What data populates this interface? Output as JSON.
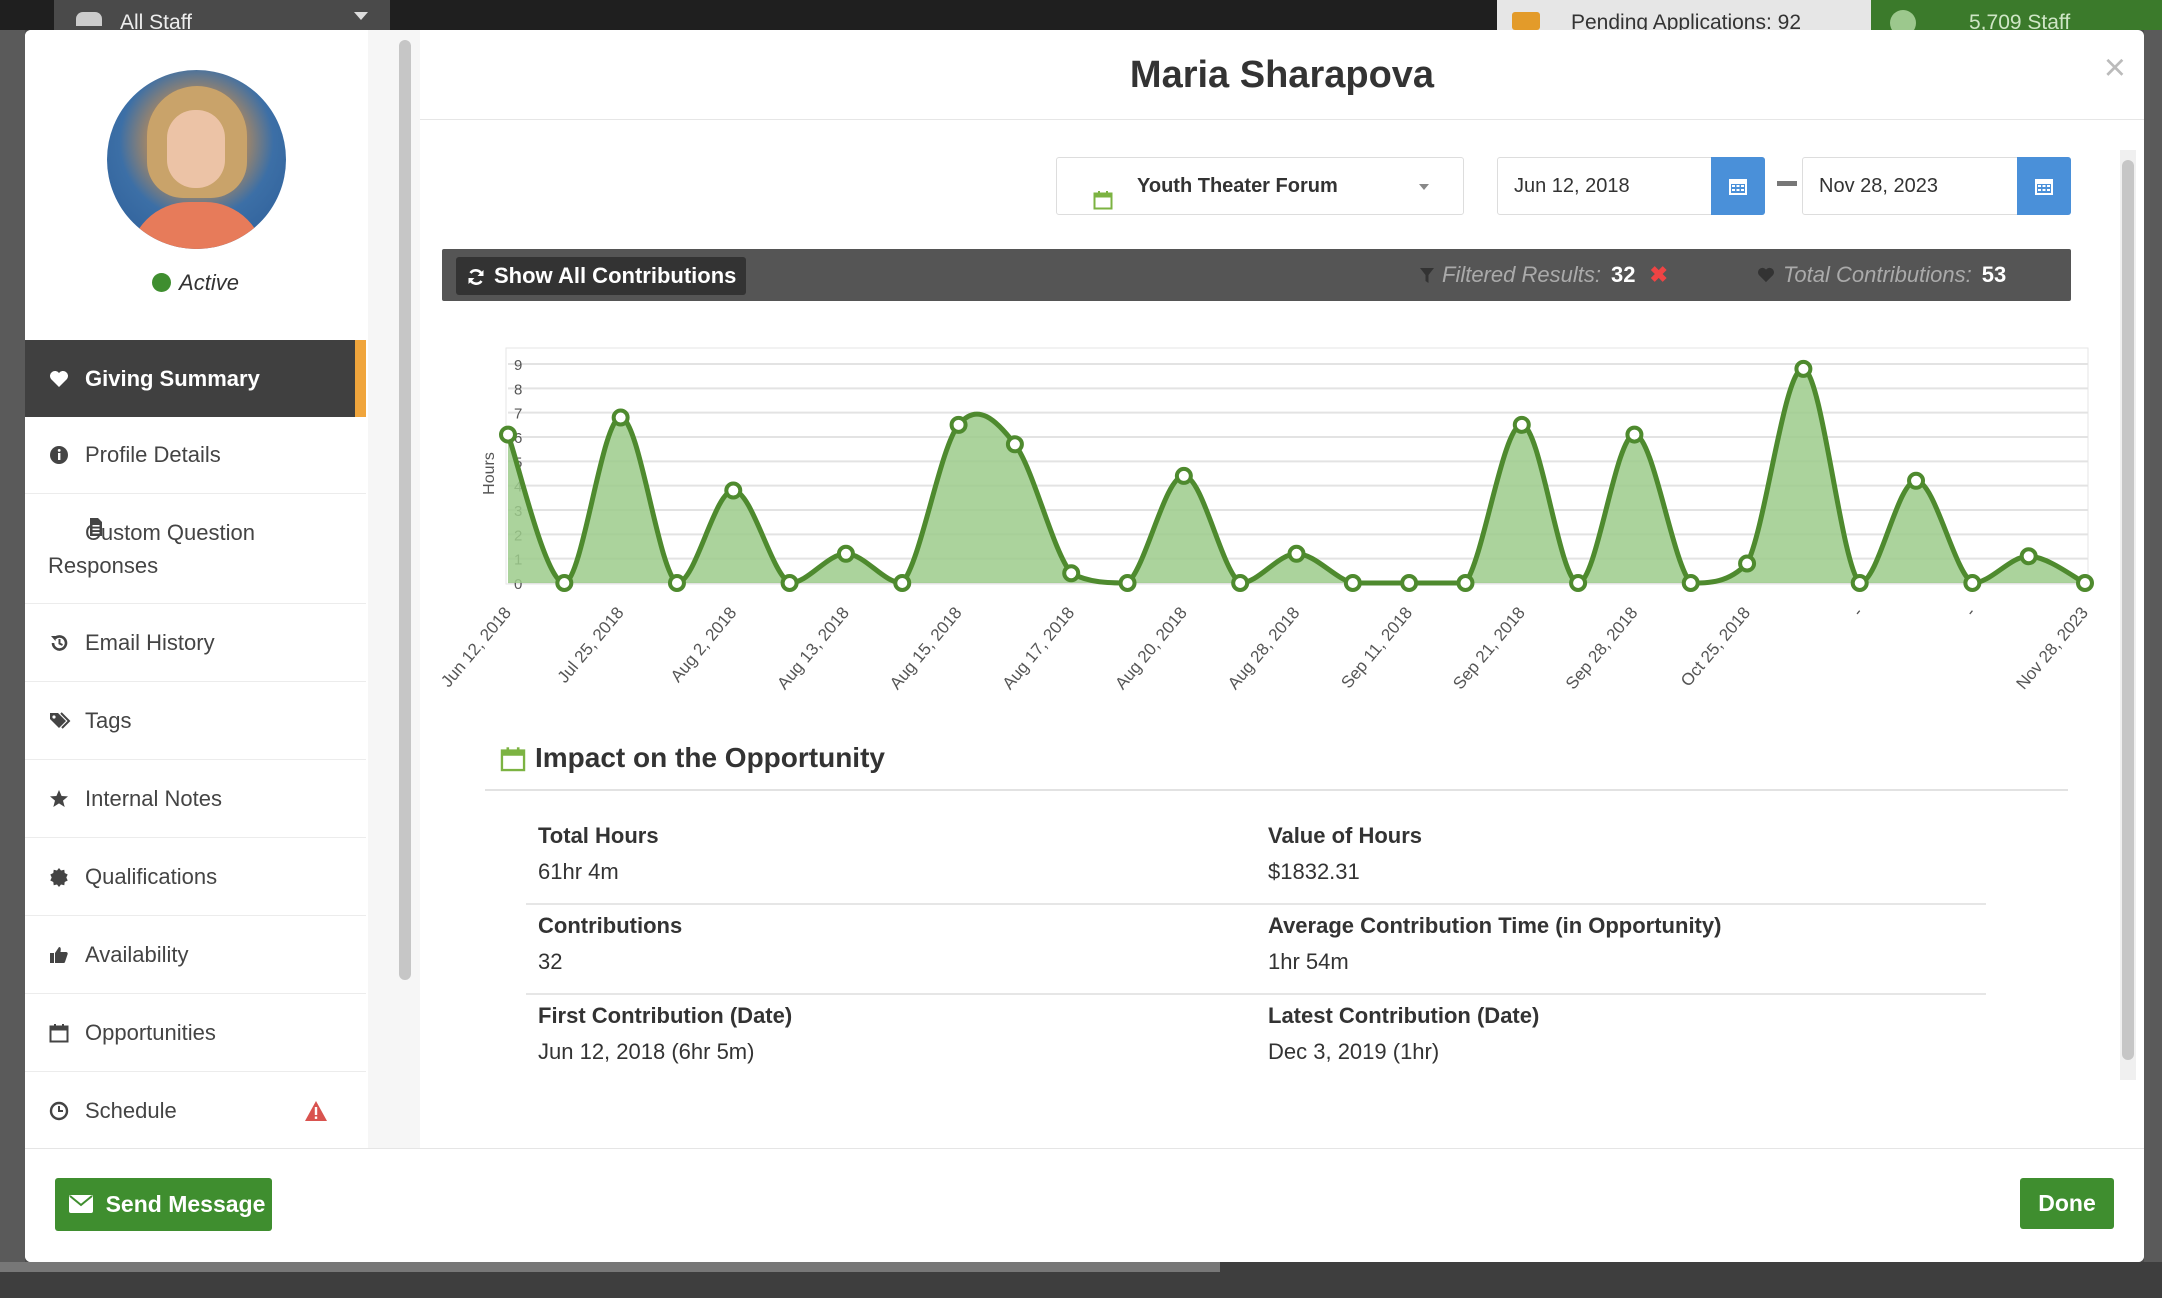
{
  "background": {
    "staff_filter_label": "All Staff",
    "pending_label": "Pending Applications: 92",
    "staff_count_label": "5,709  Staff"
  },
  "profile": {
    "name": "Maria Sharapova",
    "status": "Active"
  },
  "sidebar": {
    "items": [
      {
        "label": "Giving Summary",
        "icon": "heart-icon",
        "active": true
      },
      {
        "label": "Profile Details",
        "icon": "info-icon"
      },
      {
        "label": "Custom Question Responses",
        "icon": "document-icon"
      },
      {
        "label": "Email History",
        "icon": "history-icon"
      },
      {
        "label": "Tags",
        "icon": "tags-icon"
      },
      {
        "label": "Internal Notes",
        "icon": "star-icon"
      },
      {
        "label": "Qualifications",
        "icon": "badge-icon"
      },
      {
        "label": "Availability",
        "icon": "thumbs-up-icon"
      },
      {
        "label": "Opportunities",
        "icon": "calendar-icon"
      },
      {
        "label": "Schedule",
        "icon": "clock-icon",
        "alert": "warning-icon"
      }
    ]
  },
  "filters": {
    "opportunity": "Youth Theater Forum",
    "start_date": "Jun 12, 2018",
    "end_date": "Nov 28, 2023"
  },
  "toolbar": {
    "show_all_label": "Show All Contributions",
    "filtered_label": "Filtered Results:",
    "filtered_count": "32",
    "total_label": "Total Contributions:",
    "total_count": "53"
  },
  "chart_data": {
    "type": "area",
    "ylabel": "Hours",
    "ylim": [
      0,
      9
    ],
    "yticks": [
      0,
      1,
      2,
      3,
      4,
      5,
      6,
      7,
      8,
      9
    ],
    "x_labels": [
      "Jun 12, 2018",
      "Jul 25, 2018",
      "Aug 2, 2018",
      "Aug 13, 2018",
      "Aug 15, 2018",
      "Aug 17, 2018",
      "Aug 20, 2018",
      "Aug 28, 2018",
      "Sep 11, 2018",
      "Sep 21, 2018",
      "Sep 28, 2018",
      "Oct 25, 2018",
      "-",
      "-",
      "Nov 28, 2023"
    ],
    "values": [
      6.1,
      0,
      6.8,
      0,
      3.8,
      0,
      1.2,
      0,
      6.5,
      5.7,
      0.4,
      0,
      4.4,
      0,
      1.2,
      0,
      0,
      0,
      6.5,
      0,
      6.1,
      0,
      0.8,
      8.8,
      0,
      4.2,
      0,
      1.1,
      0
    ],
    "color": "#4e8a2e",
    "fill": "#9ccb8b",
    "grid": true
  },
  "impact": {
    "title": "Impact on the Opportunity",
    "stats": [
      {
        "label": "Total Hours",
        "value": "61hr 4m"
      },
      {
        "label": "Value of Hours",
        "value": "$1832.31"
      },
      {
        "label": "Contributions",
        "value": "32"
      },
      {
        "label": "Average Contribution Time (in Opportunity)",
        "value": "1hr 54m"
      },
      {
        "label": "First Contribution (Date)",
        "value": "Jun 12, 2018 (6hr 5m)"
      },
      {
        "label": "Latest Contribution (Date)",
        "value": "Dec 3, 2019 (1hr)"
      }
    ]
  },
  "footer": {
    "send_label": "Send Message",
    "done_label": "Done"
  },
  "colors": {
    "accent_green": "#3f8e2f",
    "active_bar": "#f0a53c",
    "date_button": "#4a90d9"
  }
}
